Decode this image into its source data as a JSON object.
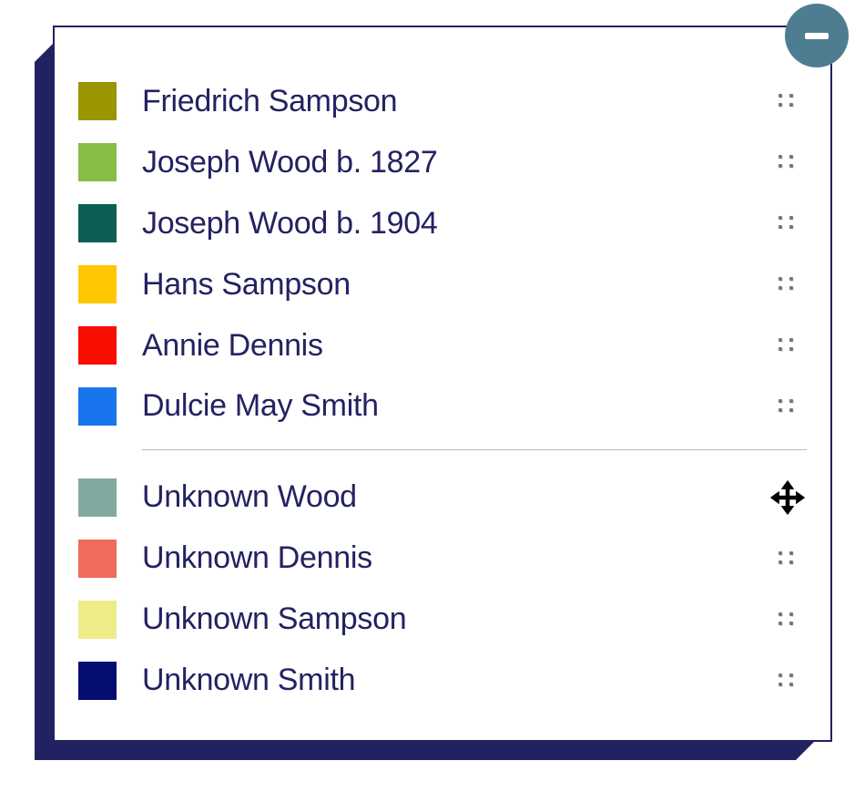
{
  "collapse": {
    "name": "collapse-button",
    "icon": "minus-icon"
  },
  "legend": {
    "groups": [
      {
        "items": [
          {
            "label": "Friedrich Sampson",
            "color": "#999600",
            "name": "legend-item-friedrich-sampson",
            "handle": "grip"
          },
          {
            "label": "Joseph Wood b. 1827",
            "color": "#89bc47",
            "name": "legend-item-joseph-wood-1827",
            "handle": "grip"
          },
          {
            "label": "Joseph Wood b. 1904",
            "color": "#0d5f55",
            "name": "legend-item-joseph-wood-1904",
            "handle": "grip"
          },
          {
            "label": "Hans Sampson",
            "color": "#ffc700",
            "name": "legend-item-hans-sampson",
            "handle": "grip"
          },
          {
            "label": "Annie Dennis",
            "color": "#f80d01",
            "name": "legend-item-annie-dennis",
            "handle": "grip"
          },
          {
            "label": "Dulcie May Smith",
            "color": "#1975ed",
            "name": "legend-item-dulcie-may-smith",
            "handle": "grip"
          }
        ]
      },
      {
        "items": [
          {
            "label": "Unknown Wood",
            "color": "#80aaa0",
            "name": "legend-item-unknown-wood",
            "handle": "move"
          },
          {
            "label": "Unknown Dennis",
            "color": "#ef6b5d",
            "name": "legend-item-unknown-dennis",
            "handle": "grip"
          },
          {
            "label": "Unknown Sampson",
            "color": "#eced87",
            "name": "legend-item-unknown-sampson",
            "handle": "grip"
          },
          {
            "label": "Unknown Smith",
            "color": "#050c72",
            "name": "legend-item-unknown-smith",
            "handle": "grip"
          }
        ]
      }
    ]
  }
}
